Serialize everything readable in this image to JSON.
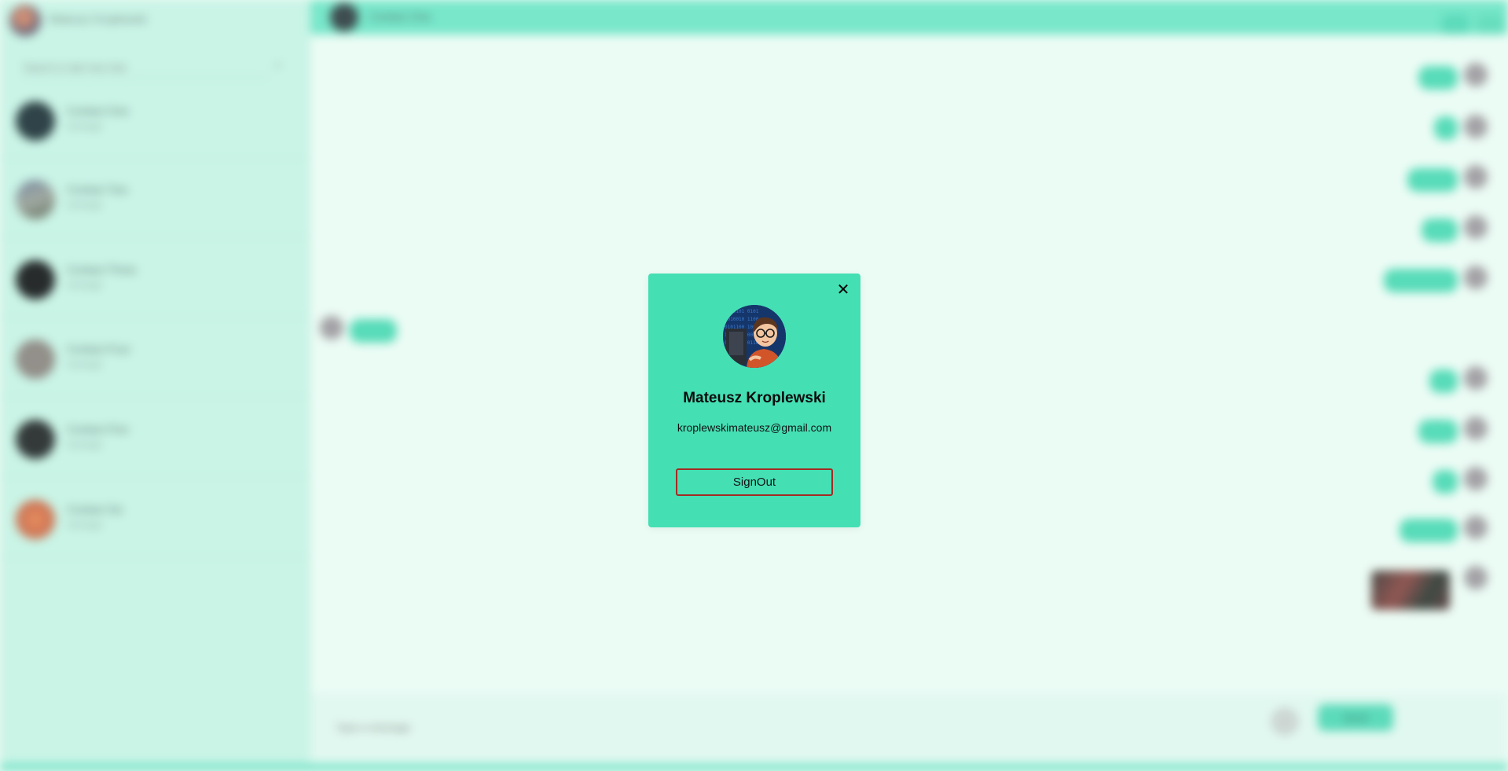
{
  "sidebar": {
    "me_name": "Mateusz Kroplewski",
    "search_placeholder": "Search or start new chat",
    "contacts": [
      {
        "name": "Contact One",
        "last": "message"
      },
      {
        "name": "Contact Two",
        "last": "message"
      },
      {
        "name": "Contact Three",
        "last": "message"
      },
      {
        "name": "Contact Four",
        "last": "message"
      },
      {
        "name": "Contact Five",
        "last": "message"
      },
      {
        "name": "Contact Six",
        "last": "message"
      }
    ]
  },
  "chat": {
    "title": "Contact One",
    "composer_placeholder": "Type a message",
    "send_label": "Send"
  },
  "modal": {
    "name": "Mateusz Kroplewski",
    "email": "kroplewskimateusz@gmail.com",
    "signout_label": "SignOut",
    "close_glyph": "✕"
  },
  "colors": {
    "modal_bg": "#45dfb4",
    "signout_border": "#a42a22",
    "header_bg": "#6de5c6",
    "sidebar_bg": "#c5f3e4",
    "chat_bg": "#eafcf4"
  }
}
